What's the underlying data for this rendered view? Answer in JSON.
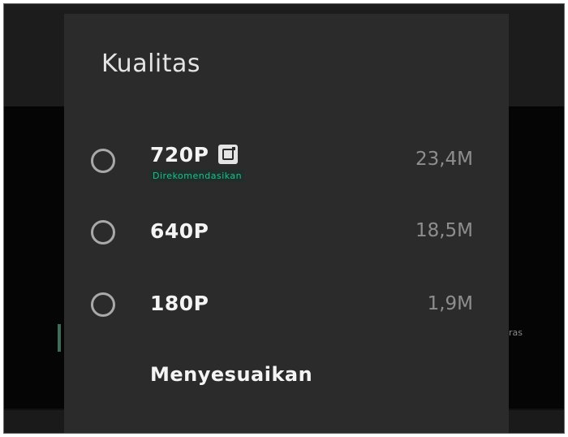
{
  "dialog": {
    "title": "Kualitas",
    "options": [
      {
        "label": "720P",
        "size": "23,4M",
        "tag": "Direkomendasikan"
      },
      {
        "label": "640P",
        "size": "18,5M"
      },
      {
        "label": "180P",
        "size": "1,9M"
      }
    ],
    "custom_label": "Menyesuaikan"
  },
  "background": {
    "partial_text": "ras"
  },
  "colors": {
    "dialog_bg": "#2b2b2b",
    "accent": "#1fbf8f",
    "radio_border": "#a9a9a9"
  }
}
